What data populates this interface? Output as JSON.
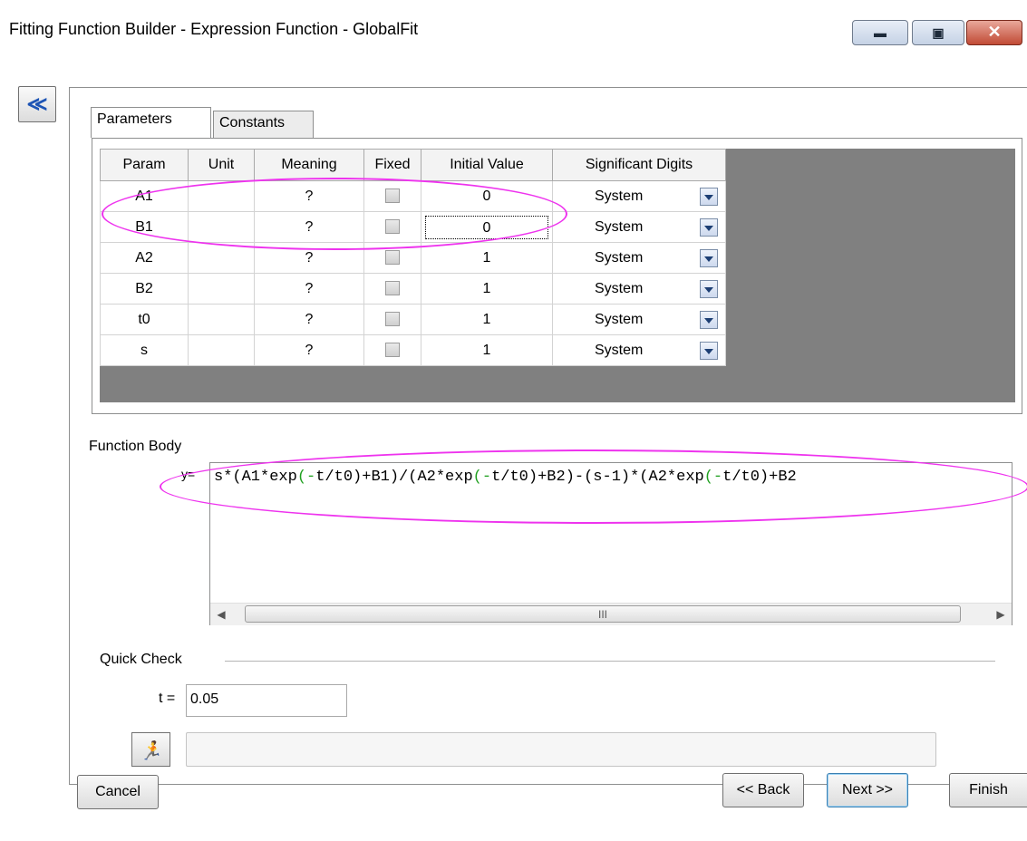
{
  "window": {
    "title": "Fitting Function Builder - Expression Function - GlobalFit",
    "minimize_glyph": "▬",
    "maximize_glyph": "▣",
    "close_glyph": "✕"
  },
  "collapse_glyph": "≪",
  "tabs": [
    {
      "label": "Parameters",
      "active": true
    },
    {
      "label": "Constants",
      "active": false
    }
  ],
  "param_table": {
    "headers": [
      "Param",
      "Unit",
      "Meaning",
      "Fixed",
      "Initial Value",
      "Significant Digits"
    ],
    "rows": [
      {
        "param": "A1",
        "unit": "",
        "meaning": "?",
        "fixed": false,
        "initial": "0",
        "sig": "System"
      },
      {
        "param": "B1",
        "unit": "",
        "meaning": "?",
        "fixed": false,
        "initial": "0",
        "sig": "System"
      },
      {
        "param": "A2",
        "unit": "",
        "meaning": "?",
        "fixed": false,
        "initial": "1",
        "sig": "System"
      },
      {
        "param": "B2",
        "unit": "",
        "meaning": "?",
        "fixed": false,
        "initial": "1",
        "sig": "System"
      },
      {
        "param": "t0",
        "unit": "",
        "meaning": "?",
        "fixed": false,
        "initial": "1",
        "sig": "System"
      },
      {
        "param": "s",
        "unit": "",
        "meaning": "?",
        "fixed": false,
        "initial": "1",
        "sig": "System"
      }
    ]
  },
  "function_body": {
    "label": "Function Body",
    "y_label": "y=",
    "code_parts": [
      {
        "text": "s*(A1*exp",
        "color": "#000000"
      },
      {
        "text": "(-",
        "color": "#20a020"
      },
      {
        "text": "t/t0)+B1)/(A2*exp",
        "color": "#000000"
      },
      {
        "text": "(-",
        "color": "#20a020"
      },
      {
        "text": "t/t0)+B2)-(s-1)*(A2*exp",
        "color": "#000000"
      },
      {
        "text": "(-",
        "color": "#20a020"
      },
      {
        "text": "t/t0)+B2",
        "color": "#000000"
      }
    ],
    "scroll_left": "◀",
    "scroll_right": "▶",
    "scroll_grip": "III"
  },
  "quick_check": {
    "label": "Quick Check",
    "var_label": "t =",
    "var_value": "0.05",
    "run_glyph": "🏃",
    "result": ""
  },
  "buttons": {
    "cancel": "Cancel",
    "back": "<< Back",
    "next": "Next >>",
    "finish": "Finish"
  },
  "colors": {
    "highlight": "#ee33ee",
    "grid_background": "#808080",
    "keyword_green": "#20a020"
  }
}
